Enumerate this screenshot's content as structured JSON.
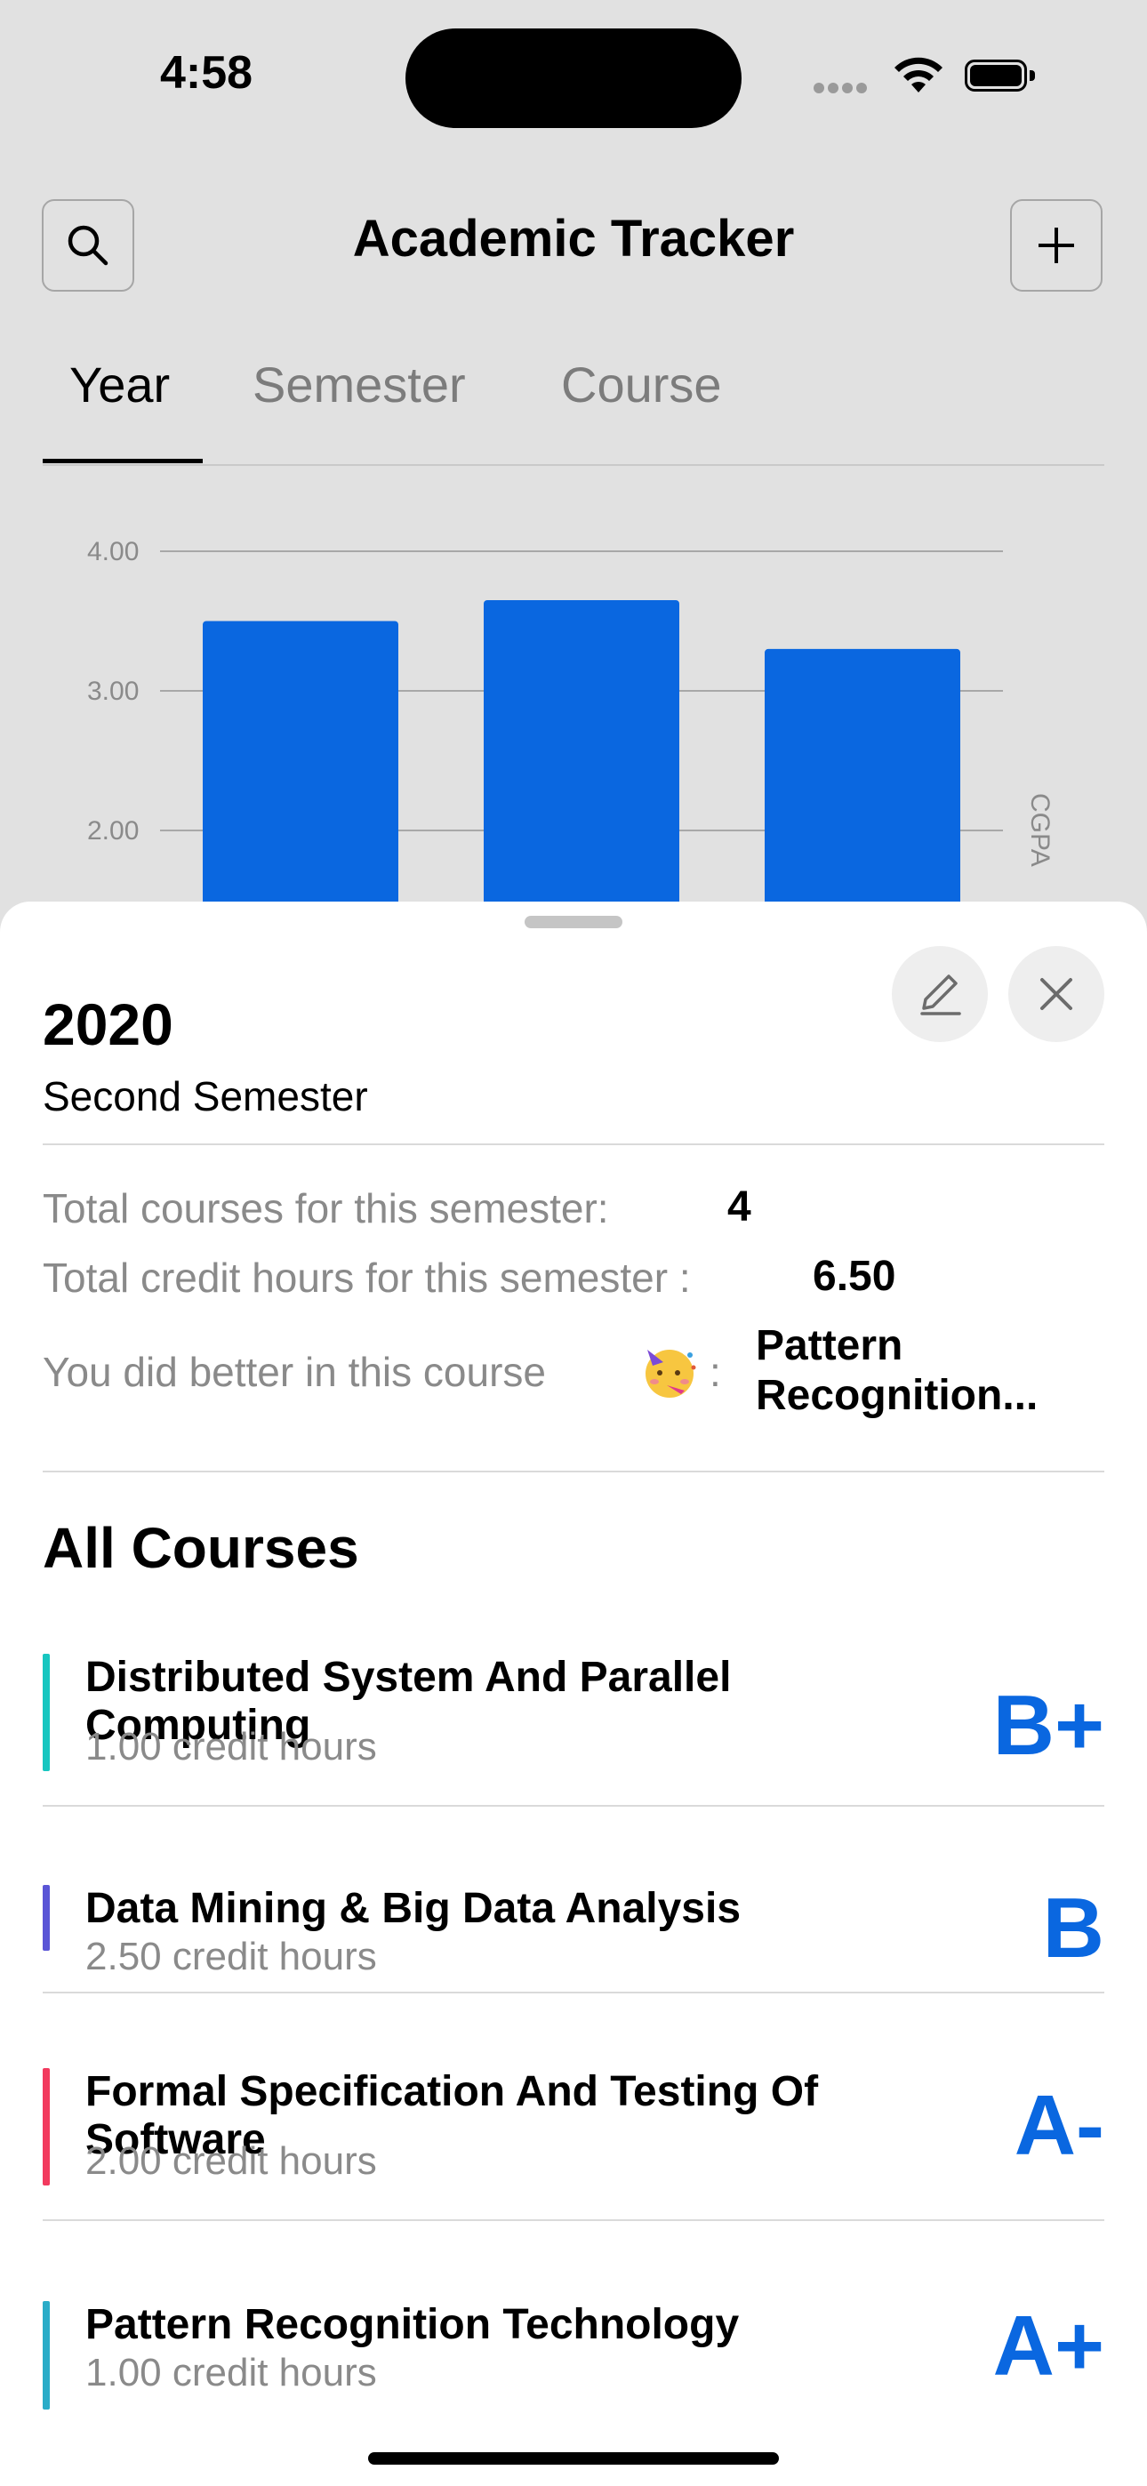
{
  "status": {
    "time": "4:58"
  },
  "header": {
    "title": "Academic Tracker"
  },
  "tabs": [
    {
      "label": "Year",
      "active": true
    },
    {
      "label": "Semester",
      "active": false
    },
    {
      "label": "Course",
      "active": false
    }
  ],
  "chart_data": {
    "type": "bar",
    "categories": [
      "",
      "",
      ""
    ],
    "values": [
      3.5,
      3.65,
      3.3
    ],
    "ylabel": "CGPA",
    "yticks": [
      "4.00",
      "3.00",
      "2.00"
    ],
    "ylim": [
      1.5,
      4.0
    ],
    "grid": true,
    "color": "#0a67e0"
  },
  "sheet": {
    "year": "2020",
    "semester": "Second Semester",
    "total_courses_label": "Total courses for this semester:",
    "total_courses_value": "4",
    "total_credit_label": "Total credit hours for this semester :",
    "total_credit_value": "6.50",
    "best_course_label": "You did better in this course",
    "best_course_sep": ":",
    "best_course_value": "Pattern Recognition...",
    "all_courses_heading": "All Courses",
    "courses": [
      {
        "name": "Distributed System And Parallel Computing",
        "credits": "1.00 credit hours",
        "grade": "B+",
        "color": "#17c6c0"
      },
      {
        "name": "Data Mining & Big Data Analysis",
        "credits": "2.50 credit hours",
        "grade": "B",
        "color": "#5a55d6"
      },
      {
        "name": "Formal Specification And Testing Of Software",
        "credits": "2.00 credit hours",
        "grade": "A-",
        "color": "#f23a5e"
      },
      {
        "name": "Pattern Recognition Technology",
        "credits": "1.00 credit hours",
        "grade": "A+",
        "color": "#2aacc8"
      }
    ]
  },
  "icons": [
    "search-icon",
    "plus-icon",
    "pencil-icon",
    "close-icon",
    "party-face-emoji",
    "wifi-icon",
    "battery-icon"
  ]
}
